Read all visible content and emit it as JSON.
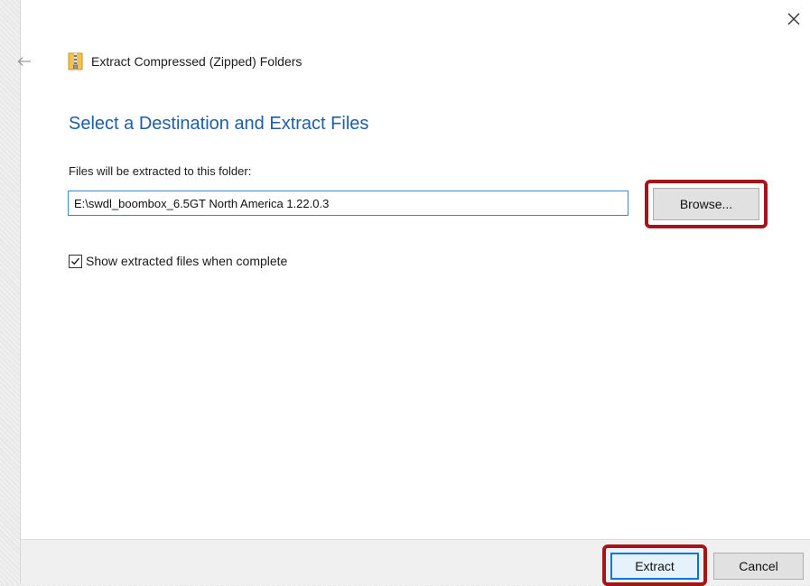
{
  "window": {
    "title": "Extract Compressed (Zipped) Folders",
    "icon": "zip-folder-icon"
  },
  "navigation": {
    "back_icon": "back-arrow-icon",
    "close_icon": "close-icon"
  },
  "content": {
    "heading": "Select a Destination and Extract Files",
    "destination_label": "Files will be extracted to this folder:",
    "destination_value": "E:\\swdl_boombox_6.5GT North America 1.22.0.3",
    "browse_label": "Browse...",
    "show_files_label": "Show extracted files when complete",
    "show_files_checked": true
  },
  "footer": {
    "extract_label": "Extract",
    "cancel_label": "Cancel"
  },
  "colors": {
    "heading": "#1f5ea8",
    "highlight": "#a51417",
    "focus": "#0078d7"
  }
}
